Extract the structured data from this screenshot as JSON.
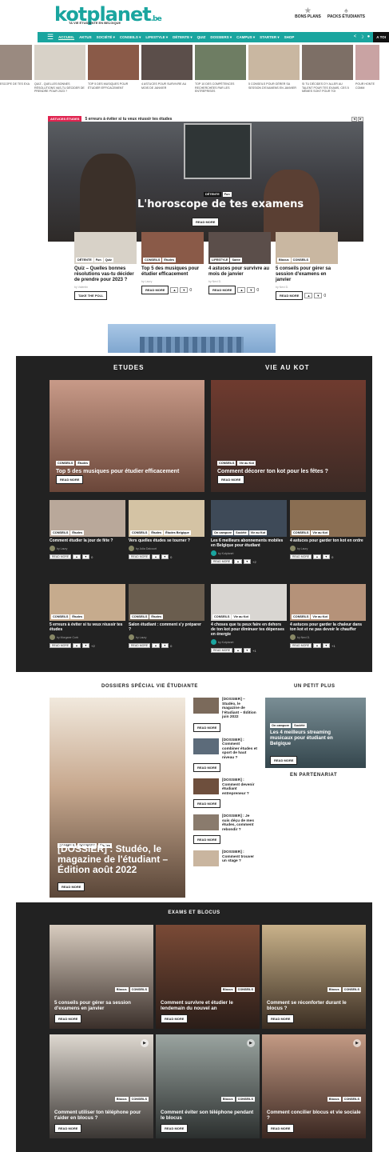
{
  "header": {
    "logo": "kotplanet",
    "logo_suffix": ".be",
    "tagline": "TA VIE ÉTUDIANTE EN BELGIQUE",
    "links": [
      {
        "label": "BONS PLANS",
        "icon": "star-icon"
      },
      {
        "label": "PACKS ÉTUDIANTS",
        "icon": "gift-icon"
      }
    ]
  },
  "nav": {
    "items": [
      "ACCUEIL",
      "AKTUS",
      "SOCIÉTÉ ▾",
      "CONSEILS ▾",
      "LIFESTYLE ▾",
      "DÉTENTE ▾",
      "QUIZ",
      "DOSSIERS ▾",
      "CAMPUS ▾",
      "STARTER ▾",
      "SHOP"
    ],
    "cta": "A TOI"
  },
  "strip": [
    "ESCOPE DE TES EXA",
    "QUIZ - QUELLES BONNES RÉSOLUTIONS VAS-TU DÉCIDER DE PRENDRE POUR 2023 ?",
    "TOP 5 DES MUSIQUES POUR ÉTUDIER EFFICACEMENT",
    "4 ASTUCES POUR SURVIVRE AU MOIS DE JANVIER",
    "TOP 10 DES COMPÉTENCES RECHERCHÉES PAR LES ENTREPRISES",
    "5 CONSEILS POUR GÉRER SA SESSION D'EXAMENS EN JANVIER",
    "SI TU DÉCIDES D'Y ALLER AU TALENT POUR TES EXAMS, CES 5 MÈMES SONT POUR TOI",
    "POUR HONTE COMM"
  ],
  "hero": {
    "crumb_tag": "ASTUCES ÉTUDES",
    "crumb_text": "5 erreurs à éviter si tu veux réussir tes études",
    "tags": [
      "DÉTENTE",
      "Fun"
    ],
    "title": "L'horoscope de tes examens",
    "read_more": "READ MORE"
  },
  "cards4": [
    {
      "tags": [
        "DÉTENTE",
        "Fun",
        "Quiz"
      ],
      "title": "Quiz – Quelles bonnes résolutions vas-tu décider de prendre pour 2023 ?",
      "by": "by Valentin",
      "btn": "TAKE THE POLL"
    },
    {
      "tags": [
        "CONSEILS",
        "Études"
      ],
      "title": "Top 5 des musiques pour étudier efficacement",
      "by": "by Laury",
      "btn": "READ MORE",
      "votes": "0"
    },
    {
      "tags": [
        "LIFESTYLE",
        "Santé"
      ],
      "title": "4 astuces pour survivre au mois de janvier",
      "by": "by Nevi D.",
      "btn": "READ MORE",
      "votes": "0"
    },
    {
      "tags": [
        "Blocus",
        "CONSEILS"
      ],
      "title": "5 conseils pour gérer sa session d'examens en janvier",
      "by": "by Nevi D.",
      "btn": "READ MORE",
      "votes": "0"
    }
  ],
  "dark": {
    "col1_title": "ETUDES",
    "col2_title": "VIE AU KOT",
    "feat1": {
      "tags": [
        "CONSEILS",
        "Études"
      ],
      "title": "Top 5 des musiques pour étudier efficacement",
      "btn": "READ MORE"
    },
    "feat2": {
      "tags": [
        "CONSEILS",
        "Vie au Kot"
      ],
      "title": "Comment décorer ton kot pour les fêtes ?",
      "btn": "READ MORE"
    },
    "small": [
      {
        "tags": [
          "CONSEILS",
          "Études"
        ],
        "title": "Comment étudier la jour de fête ?",
        "by": "by Laury",
        "votes": "0"
      },
      {
        "tags": [
          "CONSEILS",
          "Études",
          "Études Belgique"
        ],
        "title": "Vers quelles études se tourner ?",
        "by": "by Julia Dalcourt",
        "votes": "0"
      },
      {
        "tags": [
          "On campore",
          "Société",
          "Vie au Kot"
        ],
        "title": "Les 6 meilleurs abonnements mobiles en Belgique pour étudiant",
        "by": "by Kotplanet",
        "votes": "+2"
      },
      {
        "tags": [
          "CONSEILS",
          "Vie au Kot"
        ],
        "title": "4 astuces pour garder ton kot en ordre",
        "by": "by Laury",
        "votes": "0"
      },
      {
        "tags": [
          "CONSEILS",
          "Études"
        ],
        "title": "5 erreurs à éviter si tu veux réussir tes études",
        "by": "by Morgane Corb",
        "votes": "+2"
      },
      {
        "tags": [
          "CONSEILS",
          "Études"
        ],
        "title": "Salon étudiant : comment s'y préparer ?",
        "by": "by Laury",
        "votes": "0"
      },
      {
        "tags": [
          "CONSEILS",
          "Vie au Kot"
        ],
        "title": "4 choses que tu peux faire en dehors de ton kot pour diminuer tes dépenses en énergie",
        "by": "by Kotplanet",
        "votes": "+1"
      },
      {
        "tags": [
          "CONSEILS",
          "Vie au Kot"
        ],
        "title": "4 astuces pour garder la chaleur dans ton kot et ne pas devoir le chauffer",
        "by": "by Nevi D.",
        "votes": "+1"
      }
    ],
    "read_more": "READ MORE"
  },
  "dossiers": {
    "title": "DOSSIERS SPÉCIAL VIE ÉTUDIANTE",
    "big": {
      "tags": [
        "CONSEILS",
        "DOSSIERS",
        "Études"
      ],
      "title": "[DOSSIER] : Studéo, le magazine de l'étudiant – Édition août 2022",
      "btn": "READ MORE"
    },
    "list": [
      "[DOSSIER] – Studéo, le magazine de l'étudiant – Édition juin 2022",
      "[DOSSIER] : Comment combiner études et sport de haut niveau ?",
      "[DOSSIER] : Comment devenir étudiant entrepreneur ?",
      "[DOSSIER] : Je suis déçu de mes études, comment rebondir ?",
      "[DOSSIER] : Comment trouver un stage ?"
    ],
    "read_more": "READ MORE"
  },
  "plus": {
    "title": "UN PETIT PLUS",
    "tags": [
      "On campore",
      "Société"
    ],
    "card_title": "Les 4 meilleurs streaming musicaux pour étudiant en Belgique",
    "btn": "READ MORE",
    "partner": "EN PARTENARIAT"
  },
  "exams": {
    "title": "EXAMS ET BLOCUS",
    "items": [
      {
        "tags": [
          "Blocus",
          "CONSEILS"
        ],
        "title": "5 conseils pour gérer sa session d'examens en janvier",
        "btn": "READ MORE"
      },
      {
        "tags": [
          "Blocus",
          "CONSEILS"
        ],
        "title": "Comment survivre et étudier le lendemain du nouvel an",
        "btn": "READ MORE"
      },
      {
        "tags": [
          "Blocus",
          "CONSEILS"
        ],
        "title": "Comment se réconforter durant le blocus ?",
        "btn": "READ MORE"
      },
      {
        "tags": [
          "Blocus",
          "CONSEILS"
        ],
        "title": "Comment utiliser ton téléphone pour t'aider en blocus ?",
        "btn": "READ MORE"
      },
      {
        "tags": [
          "Blocus",
          "CONSEILS"
        ],
        "title": "Comment éviter son téléphone pendant le blocus",
        "btn": "READ MORE"
      },
      {
        "tags": [
          "Blocus",
          "CONSEILS"
        ],
        "title": "Comment concilier blocus et vie sociale ?",
        "btn": "READ MORE"
      }
    ]
  },
  "colors": {
    "brand": "#1aa59f",
    "accent": "#e0234f",
    "dark": "#222222"
  }
}
